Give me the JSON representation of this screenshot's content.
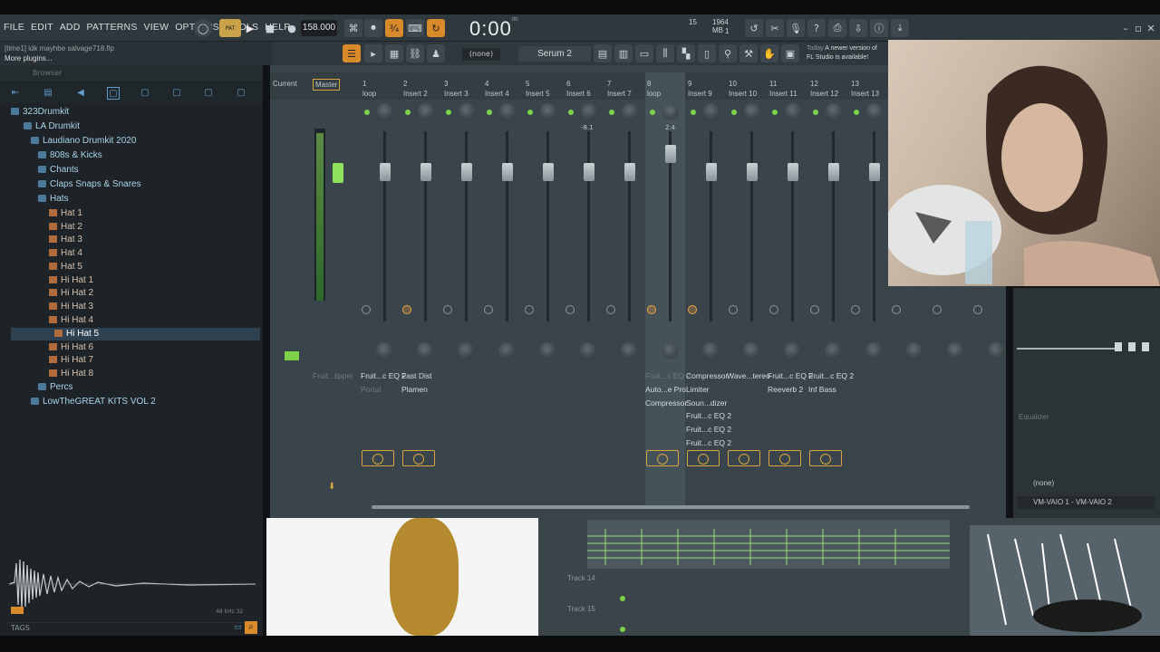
{
  "menu": [
    "FILE",
    "EDIT",
    "ADD",
    "PATTERNS",
    "VIEW",
    "OPTIONS",
    "TOOLS",
    "HELP"
  ],
  "transport": {
    "bpm": "158.000",
    "time": "0:00",
    "time_small": "00",
    "time_unit": "M:S:CS",
    "memory_value": "15",
    "memory_mb": "1964 MB",
    "memory_sub": "1"
  },
  "hint": {
    "project": "[time1] idk mayhbe salvage718.flp",
    "more_plugins": "More plugins..."
  },
  "toolbar": {
    "pattern": "(none)",
    "channel": "Serum 2"
  },
  "news": {
    "date": "Today",
    "line1": "A newer version of",
    "line2": "FL Studio is available!"
  },
  "browser": {
    "title": "Browser",
    "items": [
      {
        "label": "323Drumkit",
        "type": "folder"
      },
      {
        "label": "LA Drumkit",
        "type": "folder"
      },
      {
        "label": "Laudiano Drumkit 2020",
        "type": "folder"
      },
      {
        "label": "808s & Kicks",
        "type": "folder"
      },
      {
        "label": "Chants",
        "type": "folder"
      },
      {
        "label": "Claps Snaps & Snares",
        "type": "folder"
      },
      {
        "label": "Hats",
        "type": "folder"
      },
      {
        "label": "Hat 1",
        "type": "file"
      },
      {
        "label": "Hat 2",
        "type": "file"
      },
      {
        "label": "Hat 3",
        "type": "file"
      },
      {
        "label": "Hat 4",
        "type": "file"
      },
      {
        "label": "Hat 5",
        "type": "file"
      },
      {
        "label": "Hi Hat 1",
        "type": "file"
      },
      {
        "label": "Hi Hat 2",
        "type": "file"
      },
      {
        "label": "Hi Hat 3",
        "type": "file"
      },
      {
        "label": "Hi Hat 4",
        "type": "file"
      },
      {
        "label": "Hi Hat 5",
        "type": "file"
      },
      {
        "label": "Hi Hat 6",
        "type": "file"
      },
      {
        "label": "Hi Hat 7",
        "type": "file"
      },
      {
        "label": "Hi Hat 8",
        "type": "file"
      },
      {
        "label": "Percs",
        "type": "folder"
      },
      {
        "label": "LowTheGREAT KITS VOL 2",
        "type": "folder"
      }
    ],
    "waveform_info": "48 kHz 32",
    "tags": "TAGS"
  },
  "mixer": {
    "strips": [
      {
        "num": "",
        "name": "Current"
      },
      {
        "num": "",
        "name": "Master"
      },
      {
        "num": "1",
        "name": "loop"
      },
      {
        "num": "2",
        "name": "Insert 2"
      },
      {
        "num": "3",
        "name": "Insert 3"
      },
      {
        "num": "4",
        "name": "Insert 4"
      },
      {
        "num": "5",
        "name": "Insert 5"
      },
      {
        "num": "6",
        "name": "Insert 6"
      },
      {
        "num": "7",
        "name": "Insert 7"
      },
      {
        "num": "8",
        "name": "loop"
      },
      {
        "num": "9",
        "name": "Insert 9"
      },
      {
        "num": "10",
        "name": "Insert 10"
      },
      {
        "num": "11",
        "name": "Insert 11"
      },
      {
        "num": "12",
        "name": "Insert 12"
      },
      {
        "num": "13",
        "name": "Insert 13"
      }
    ],
    "peak_6": "-8.1",
    "peak_8": "2.4",
    "fx_master": "Fruit...lipper",
    "fx_col1": [
      "Fruit...c EQ 2",
      "Portal"
    ],
    "fx_col2": [
      "Fast Dist",
      "Plamen"
    ],
    "fx_col8": [
      "Fruit...c EQ 2",
      "Auto...e Pro",
      "Compressor"
    ],
    "fx_col9": [
      "Compressor",
      "Limiter",
      "Soun...dizer",
      "Fruit...c EQ 2",
      "Fruit...c EQ 2",
      "Fruit...c EQ 2"
    ],
    "fx_col10": [
      "Wave...tereo"
    ],
    "fx_col11": [
      "Fruit...c EQ 2",
      "Reeverb 2"
    ],
    "fx_col12": [
      "Fruit...c EQ 2",
      "Inf Bass"
    ]
  },
  "rightpanel": {
    "equalizer": "Equalizer",
    "none": "(none)",
    "output": "VM-VAIO 1 - VM-VAIO 2"
  },
  "playlist": {
    "track14": "Track 14",
    "track15": "Track 15"
  }
}
